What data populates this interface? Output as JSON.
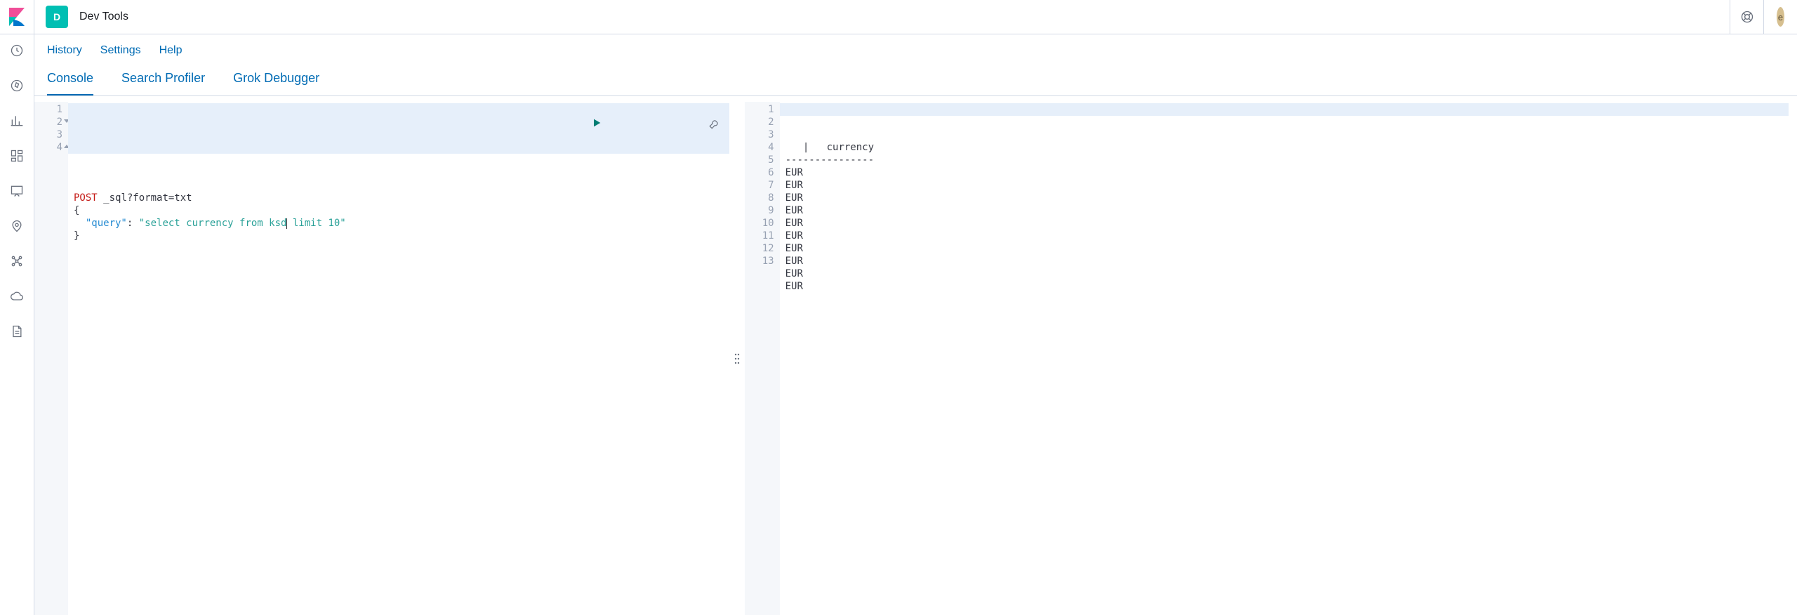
{
  "header": {
    "app_badge": "D",
    "title": "Dev Tools",
    "avatar": "e"
  },
  "toolbar": {
    "history": "History",
    "settings": "Settings",
    "help": "Help"
  },
  "tabs": {
    "console": "Console",
    "search_profiler": "Search Profiler",
    "grok_debugger": "Grok Debugger"
  },
  "editor": {
    "gutter": [
      "1",
      "2",
      "3",
      "4"
    ],
    "method": "POST",
    "path": "_sql?format=txt",
    "brace_open": "{",
    "query_key": "\"query\"",
    "colon": ": ",
    "query_before": "\"select currency from ksd",
    "query_after": " limit 10\"",
    "brace_close": "}"
  },
  "output": {
    "gutter": [
      "1",
      "2",
      "3",
      "4",
      "5",
      "6",
      "7",
      "8",
      "9",
      "10",
      "11",
      "12",
      "13"
    ],
    "lines": [
      "   |   currency",
      "---------------",
      "EUR",
      "EUR",
      "EUR",
      "EUR",
      "EUR",
      "EUR",
      "EUR",
      "EUR",
      "EUR",
      "EUR",
      ""
    ]
  }
}
